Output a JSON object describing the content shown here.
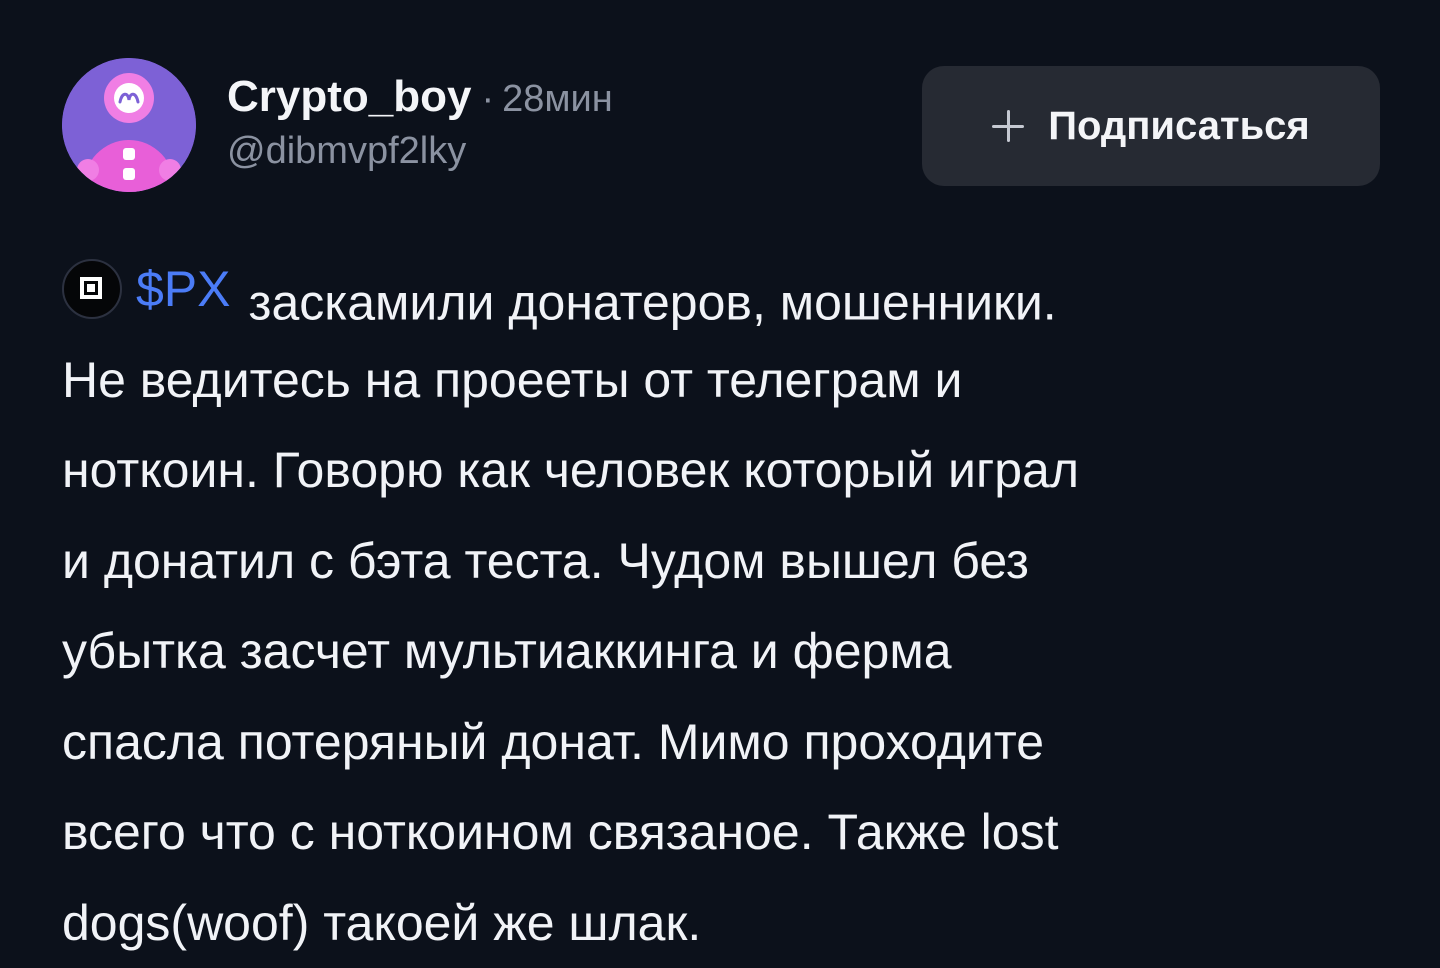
{
  "post": {
    "author": {
      "name": "Crypto_boy",
      "handle": "@dibmvpf2lky"
    },
    "separator": "·",
    "time": "28мин",
    "subscribe_label": "Подписаться",
    "ticker": "$PX",
    "line1_rest": "заскамили донатеров, мошенники.",
    "lines": [
      "Не ведитесь на проееты от телеграм и",
      "ноткоин. Говорю как человек который играл",
      "и донатил с бэта теста. Чудом вышел без",
      "убытка засчет мультиаккинга и ферма",
      "спасла потеряный донат. Мимо проходите",
      "всего что с ноткоином связаное. Также lost",
      "dogs(woof) такоей же шлак."
    ]
  },
  "colors": {
    "background": "#0c111b",
    "ticker": "#4b7cf7",
    "muted": "#8b92a1",
    "button_bg": "#262a33",
    "avatar_bg": "#7d61d6"
  },
  "icons": {
    "avatar": "pink-snowman-avatar-icon",
    "subscribe": "plus-icon",
    "token": "px-token-icon"
  }
}
